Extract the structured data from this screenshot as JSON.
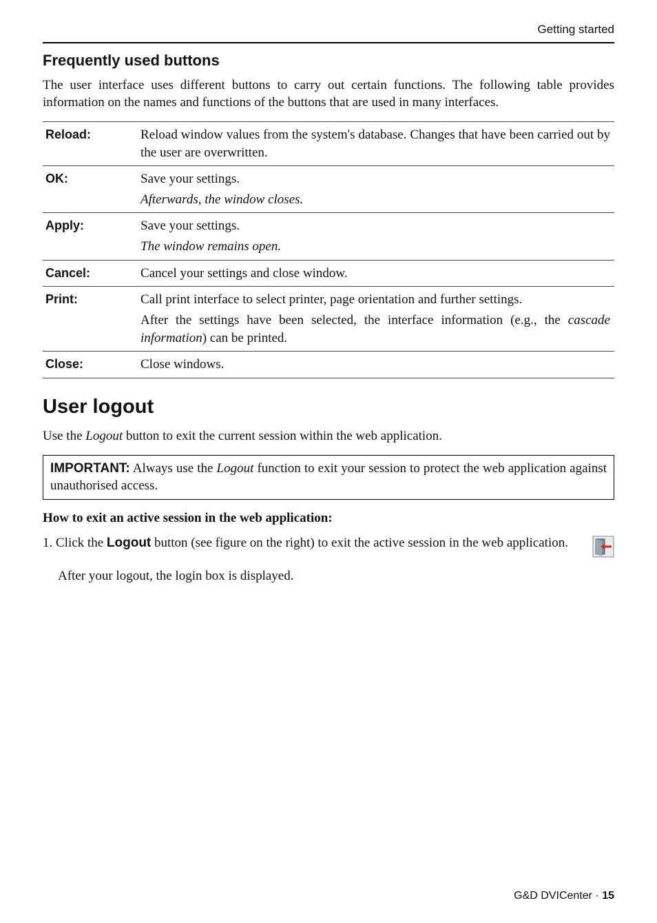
{
  "running_head": "Getting started",
  "section": {
    "heading": "Frequently used buttons",
    "intro": "The user interface uses different buttons to carry out certain functions. The following table provides information on the names and functions of the buttons that are used in many interfaces."
  },
  "table": [
    {
      "label": "Reload:",
      "paras": [
        {
          "text": "Reload window values from the system's database. Changes that have been carried out by the user are overwritten."
        }
      ]
    },
    {
      "label": "OK:",
      "paras": [
        {
          "text": "Save your settings."
        },
        {
          "text": "Afterwards, the window closes.",
          "italic": true
        }
      ]
    },
    {
      "label": "Apply:",
      "paras": [
        {
          "text": "Save your settings."
        },
        {
          "text": "The window remains open.",
          "italic": true
        }
      ]
    },
    {
      "label": "Cancel:",
      "paras": [
        {
          "text": "Cancel your settings and close window."
        }
      ]
    },
    {
      "label": "Print:",
      "paras": [
        {
          "text": "Call print interface to select printer, page orientation and further settings."
        },
        {
          "html": "After the settings have been selected, the interface information (e.g., the <em>cascade information</em>) can be printed."
        }
      ]
    },
    {
      "label": "Close:",
      "paras": [
        {
          "text": "Close windows."
        }
      ]
    }
  ],
  "logout": {
    "heading": "User logout",
    "intro_pre": "Use the ",
    "intro_em": "Logout",
    "intro_post": " button to exit the current session within the web application.",
    "important_label": "IMPORTANT:",
    "important_pre": " Always use the ",
    "important_em": "Logout",
    "important_post": " function to exit your session to protect the web application against unauthorised access.",
    "howto": "How to exit an active session in the web application:",
    "step_num": "1.",
    "step_pre": "Click the ",
    "step_strong": "Logout",
    "step_post": " button (see figure on the right) to exit the active session in the web application.",
    "after": "After your logout, the login box is displayed."
  },
  "footer": {
    "product": "G&D DVICenter · ",
    "page": "15"
  }
}
